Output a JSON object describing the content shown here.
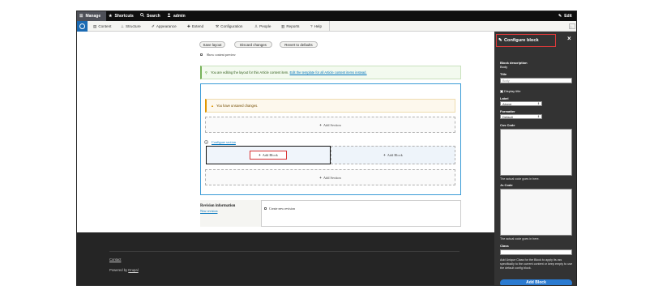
{
  "toolbar": {
    "manage": "Manage",
    "shortcuts": "Shortcuts",
    "search": "Search",
    "user": "admin",
    "edit": "Edit",
    "menu": [
      "Content",
      "Structure",
      "Appearance",
      "Extend",
      "Configuration",
      "People",
      "Reports",
      "Help"
    ]
  },
  "layout_actions": {
    "save": "Save layout",
    "discard": "Discard changes",
    "revert": "Revert to defaults",
    "show_preview": "Show content preview"
  },
  "messages": {
    "editing_prefix": "You are editing the layout for this Article content item.",
    "editing_link": "Edit the template for all Article content items instead.",
    "unsaved": "You have unsaved changes."
  },
  "builder": {
    "add_section_top": "Add Section",
    "configure_section": "Configure section",
    "add_block_left": "Add Block",
    "add_block_right": "Add Block",
    "add_section_bottom": "Add Section"
  },
  "revision": {
    "heading": "Revision information",
    "tab_sub": "New revision",
    "create_new": "Create new revision"
  },
  "footer": {
    "contact": "Contact",
    "powered_prefix": "Powered by",
    "powered_link": "Drupal"
  },
  "tray": {
    "title": "Configure block",
    "close": "×",
    "block_description_label": "Block description",
    "block_description_value": "Body",
    "title_label": "Title",
    "title_value": "Body",
    "display_title": "Display title",
    "label_label": "Label",
    "label_value": "Above",
    "formatter_label": "Formatter",
    "formatter_value": "Default",
    "css_code_label": "Css Code",
    "css_help": "The actual code goes in here.",
    "js_code_label": "Js Code",
    "js_help": "The actual code goes in here.",
    "class_label": "Class",
    "class_help": "Add Unique Class for the Block to apply its css specifically to the current content or keep empty to use the default config block.",
    "add_block": "Add Block"
  },
  "colors": {
    "toolbar_bg": "#0f0f0f",
    "tray_bg": "#333333",
    "accent_blue": "#2b7bd1",
    "highlight_red": "#d93333"
  }
}
